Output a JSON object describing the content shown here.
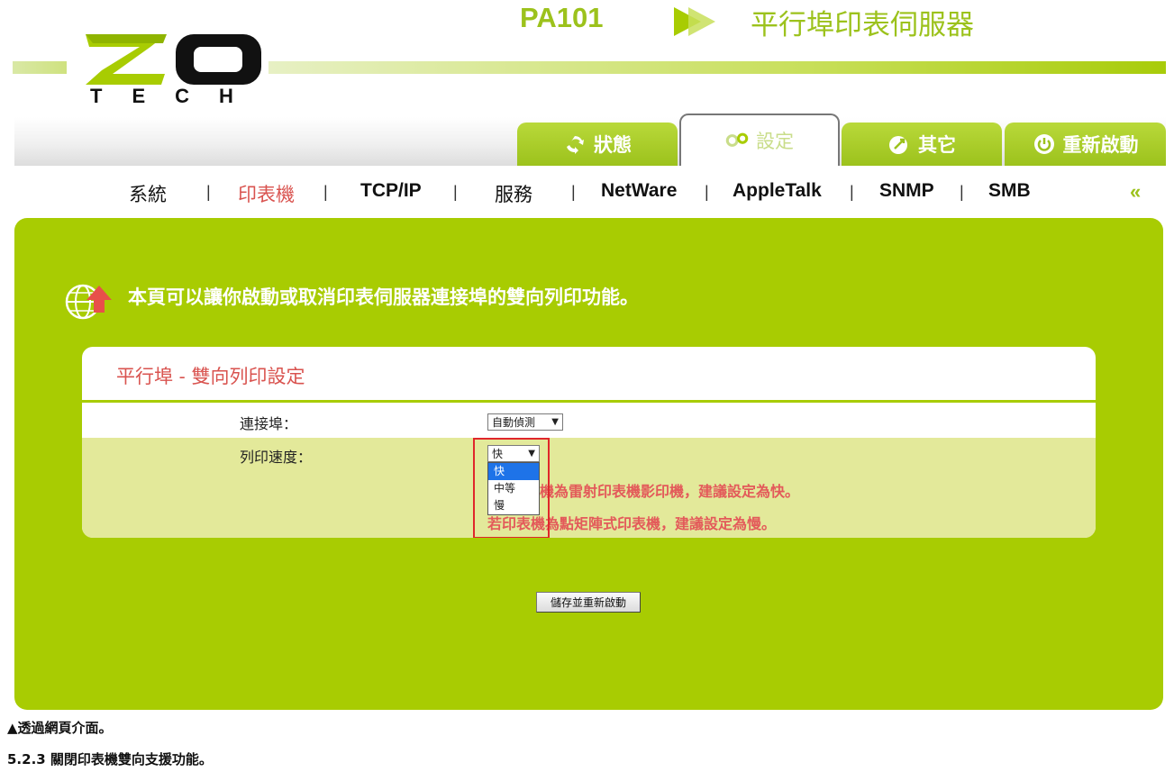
{
  "header": {
    "logo_text": "ZO",
    "logo_sub": "TECH",
    "model": "PA101",
    "product_name": "平行埠印表伺服器"
  },
  "tabs": [
    {
      "label": "狀態",
      "icon": "recycle-icon"
    },
    {
      "label": "設定",
      "icon": "gears-icon"
    },
    {
      "label": "其它",
      "icon": "globe-arrow-icon"
    },
    {
      "label": "重新啟動",
      "icon": "power-icon"
    }
  ],
  "subnav": {
    "items": [
      "系統",
      "印表機",
      "TCP/IP",
      "服務",
      "NetWare",
      "AppleTalk",
      "SNMP",
      "SMB"
    ],
    "separator": "|",
    "more": "«"
  },
  "page": {
    "description": "本頁可以讓你啟動或取消印表伺服器連接埠的雙向列印功能。",
    "section_title": "平行埠 - 雙向列印設定",
    "port_label": "連接埠：",
    "port_value": "自動偵測",
    "speed_label": "列印速度：",
    "speed_value": "快",
    "speed_options": [
      "快",
      "中等",
      "慢"
    ],
    "hint1": "若印表機為雷射印表機影印機，建議設定為快。",
    "hint1_visible": "機為雷射印表機影印機，建議設定為快。",
    "hint2": "若印表機為點矩陣式印表機，建議設定為慢。",
    "save_button": "儲存並重新啟動"
  },
  "captions": {
    "line1": "▲透過網頁介面。",
    "line2": "5.2.3 關閉印表機雙向支援功能。"
  },
  "colors": {
    "brand_green": "#a8cc02",
    "accent_red": "#d9534f",
    "hint_red": "#e35a5a",
    "row_highlight": "#e3e99a"
  }
}
